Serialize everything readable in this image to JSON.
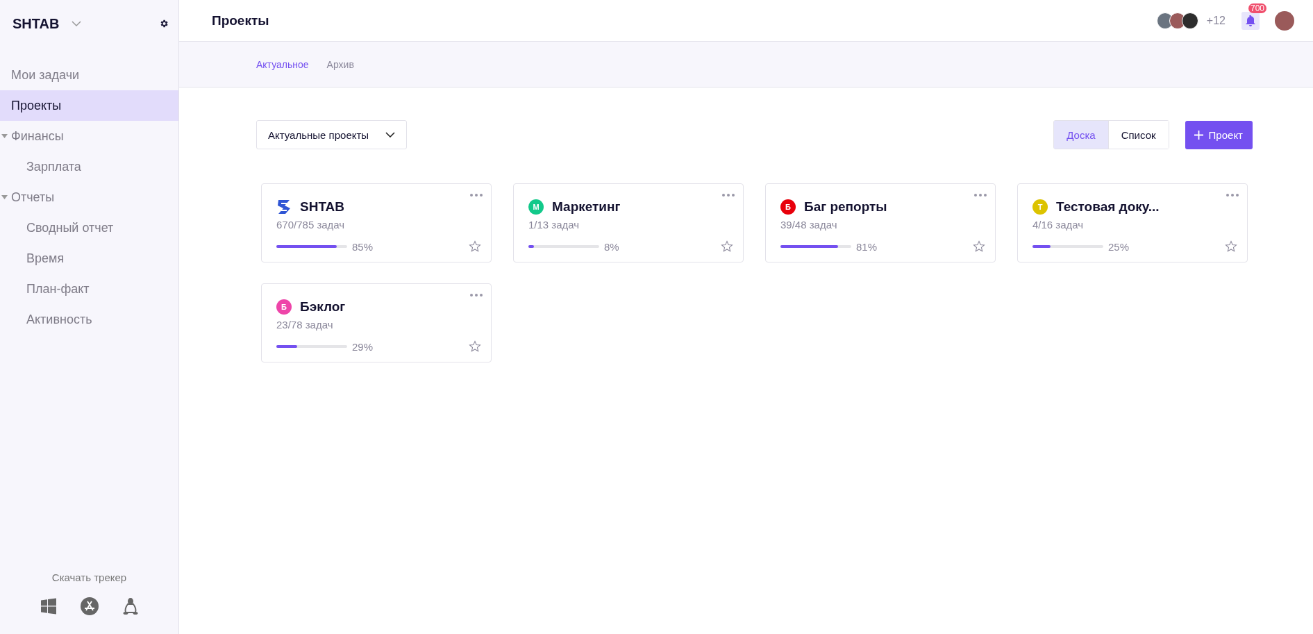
{
  "workspace": {
    "name": "SHTAB"
  },
  "sidebar": {
    "items": [
      {
        "label": "Мои задачи",
        "selected": false
      },
      {
        "label": "Проекты",
        "selected": true
      },
      {
        "label": "Финансы",
        "selected": false,
        "expanded": true,
        "children": [
          {
            "label": "Зарплата",
            "selected": false
          }
        ]
      },
      {
        "label": "Отчеты",
        "selected": false,
        "expanded": true,
        "children": [
          {
            "label": "Сводный отчет",
            "selected": false
          },
          {
            "label": "Время",
            "selected": false
          },
          {
            "label": "План-факт",
            "selected": false
          },
          {
            "label": "Активность",
            "selected": false
          }
        ]
      }
    ],
    "download": {
      "label": "Скачать трекер"
    }
  },
  "header": {
    "title": "Проекты",
    "members_more": "+12",
    "notifications": "700"
  },
  "tabs": [
    {
      "label": "Актуальное",
      "selected": true
    },
    {
      "label": "Архив",
      "selected": false
    }
  ],
  "filter": {
    "value": "Актуальные проекты"
  },
  "view_toggle": [
    {
      "label": "Доска",
      "selected": true
    },
    {
      "label": "Список",
      "selected": false
    }
  ],
  "add_button": {
    "label": "Проект"
  },
  "projects": [
    {
      "kind": "logo",
      "name": "SHTAB",
      "tasks": "670/785 задач",
      "level": 0.85,
      "percent": "85%"
    },
    {
      "kind": "letter",
      "letter": "М",
      "color": "#12c98a",
      "name": "Маркетинг",
      "tasks": "1/13 задач",
      "level": 0.08,
      "percent": "8%"
    },
    {
      "kind": "letter",
      "letter": "Б",
      "color": "#e8000b",
      "name": "Баг репорты",
      "tasks": "39/48 задач",
      "level": 0.81,
      "percent": "81%"
    },
    {
      "kind": "letter",
      "letter": "Т",
      "color": "#dcc300",
      "name": "Тестовая доку...",
      "tasks": "4/16 задач",
      "level": 0.25,
      "percent": "25%"
    },
    {
      "kind": "letter",
      "letter": "Б",
      "color": "#ee45a9",
      "name": "Бэклог",
      "tasks": "23/78 задач",
      "level": 0.29,
      "percent": "29%"
    }
  ]
}
